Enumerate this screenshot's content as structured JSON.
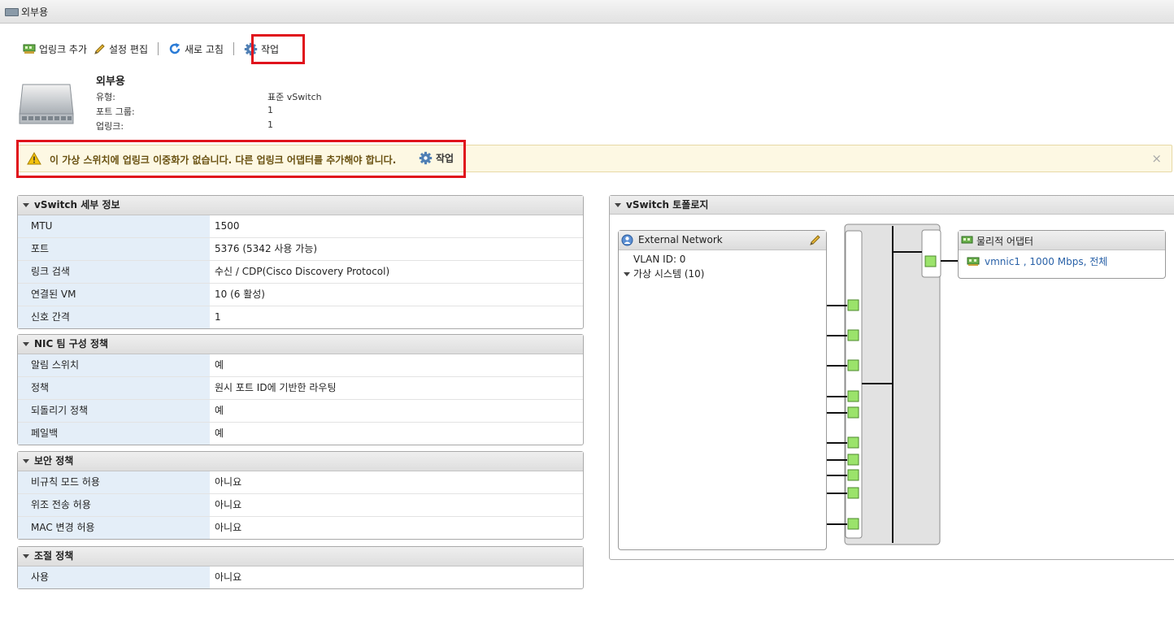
{
  "window": {
    "title": "외부용"
  },
  "toolbar": {
    "add_uplink": "업링크 추가",
    "edit_settings": "설정 편집",
    "refresh": "새로 고침",
    "actions": "작업"
  },
  "summary": {
    "name": "외부용",
    "type_label": "유형:",
    "type_value": "표준 vSwitch",
    "portgroups_label": "포트 그룹:",
    "portgroups_value": "1",
    "uplinks_label": "업링크:",
    "uplinks_value": "1"
  },
  "warning": {
    "message": "이 가상 스위치에 업링크 이중화가 없습니다. 다른 업링크 어댑터를 추가해야 합니다.",
    "action": "작업",
    "close": "×"
  },
  "details": {
    "title": "vSwitch 세부 정보",
    "rows": [
      {
        "k": "MTU",
        "v": "1500"
      },
      {
        "k": "포트",
        "v": "5376 (5342 사용 가능)"
      },
      {
        "k": "링크 검색",
        "v": "수신 / CDP(Cisco Discovery Protocol)"
      },
      {
        "k": "연결된 VM",
        "v": "10 (6 활성)"
      },
      {
        "k": "신호 간격",
        "v": "1"
      }
    ]
  },
  "nic_teaming": {
    "title": "NIC 팀 구성 정책",
    "rows": [
      {
        "k": "알림 스위치",
        "v": "예"
      },
      {
        "k": "정책",
        "v": "원시 포트 ID에 기반한 라우팅"
      },
      {
        "k": "되돌리기 정책",
        "v": "예"
      },
      {
        "k": "페일백",
        "v": "예"
      }
    ]
  },
  "security": {
    "title": "보안 정책",
    "rows": [
      {
        "k": "비규칙 모드 허용",
        "v": "아니요"
      },
      {
        "k": "위조 전송 허용",
        "v": "아니요"
      },
      {
        "k": "MAC 변경 허용",
        "v": "아니요"
      }
    ]
  },
  "shaping": {
    "title": "조절 정책",
    "rows": [
      {
        "k": "사용",
        "v": "아니요"
      }
    ]
  },
  "topology": {
    "title": "vSwitch 토폴로지",
    "portgroup": {
      "name": "External Network",
      "vlan": "VLAN ID: 0",
      "vms": "가상 시스템 (10)"
    },
    "adapters": {
      "title": "물리적 어댑터",
      "nic": "vmnic1 , 1000 Mbps, 전체"
    },
    "accent": "#9be36b"
  }
}
